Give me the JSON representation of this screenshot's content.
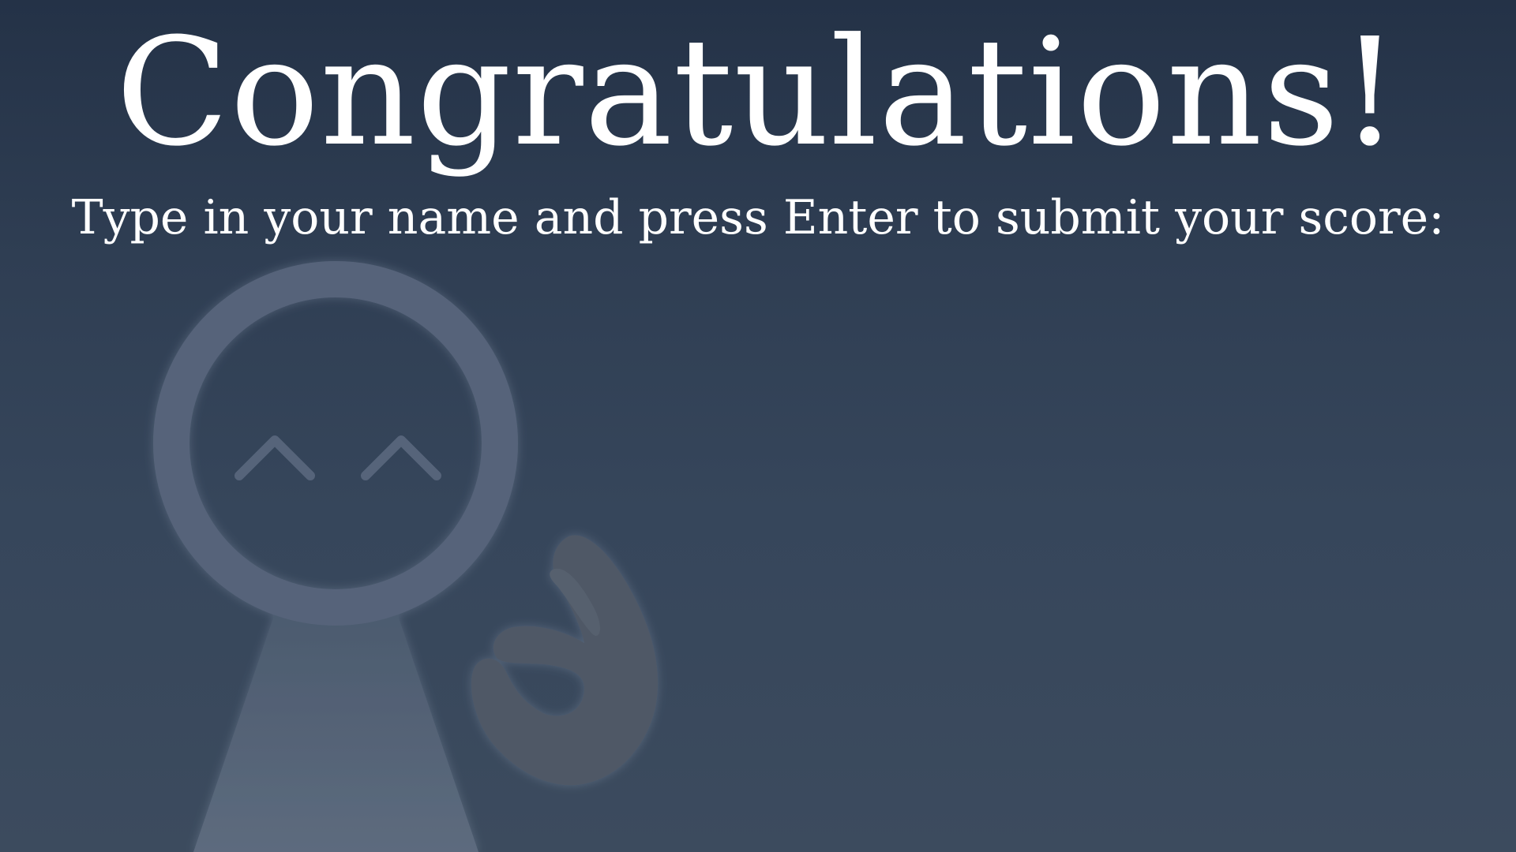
{
  "screen": {
    "title": "Congratulations!",
    "instruction": "Type in your name and press Enter to submit your score:",
    "name_input_value": ""
  },
  "mascot": {
    "icon": "smiling-figure-icon",
    "gesture_icon": "ok-hand-icon"
  },
  "colors": {
    "background_top": "#243247",
    "background_bottom": "#3c4b5e",
    "text": "#ffffff",
    "mascot": "#5a687a",
    "hand": "#4f5866"
  }
}
